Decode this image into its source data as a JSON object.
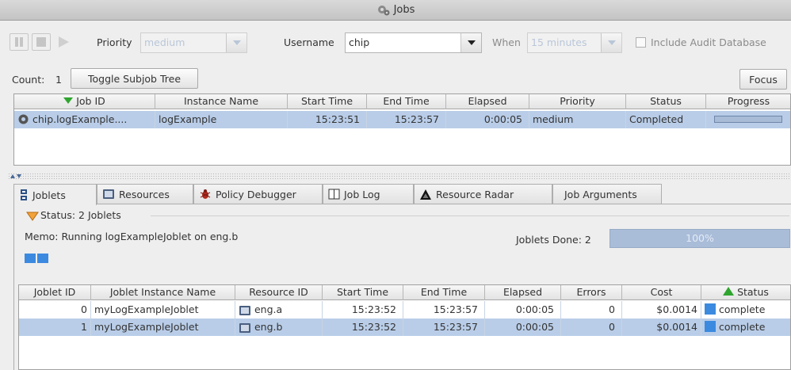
{
  "window": {
    "title": "Jobs",
    "icon": "jobs-gear-icon"
  },
  "toolbar": {
    "priority_label": "Priority",
    "priority_value": "medium",
    "username_label": "Username",
    "username_value": "chip",
    "when_label": "When",
    "when_value": "15 minutes",
    "include_audit_label": "Include Audit Database"
  },
  "count": {
    "label": "Count:",
    "value": "1",
    "toggle_button": "Toggle Subjob Tree",
    "focus_button": "Focus"
  },
  "jobs_table": {
    "columns": [
      "Job ID",
      "Instance Name",
      "Start Time",
      "End Time",
      "Elapsed",
      "Priority",
      "Status",
      "Progress"
    ],
    "rows": [
      {
        "job_id": "chip.logExample....",
        "instance_name": "logExample",
        "start_time": "15:23:51",
        "end_time": "15:23:57",
        "elapsed": "0:00:05",
        "priority": "medium",
        "status": "Completed",
        "progress": 1.0
      }
    ]
  },
  "tabs": [
    {
      "label": "Joblets",
      "icon": "joblets-icon"
    },
    {
      "label": "Resources",
      "icon": "resources-icon"
    },
    {
      "label": "Policy Debugger",
      "icon": "bug-icon"
    },
    {
      "label": "Job Log",
      "icon": "log-icon"
    },
    {
      "label": "Resource Radar",
      "icon": "radar-icon"
    },
    {
      "label": "Job Arguments",
      "icon": ""
    }
  ],
  "joblets": {
    "status_label": "Status: 2 Joblets",
    "memo": "Memo:  Running logExampleJoblet on eng.b",
    "done_label": "Joblets Done: 2",
    "done_percent": "100%",
    "done_fraction": 1.0
  },
  "joblets_table": {
    "columns": [
      "Joblet ID",
      "Joblet Instance Name",
      "Resource ID",
      "Start Time",
      "End Time",
      "Elapsed",
      "Errors",
      "Cost",
      "Status"
    ],
    "rows": [
      {
        "id": "0",
        "name": "myLogExampleJoblet",
        "resource": "eng.a",
        "start": "15:23:52",
        "end": "15:23:57",
        "elapsed": "0:00:05",
        "errors": "0",
        "cost": "$0.0014",
        "status": "complete"
      },
      {
        "id": "1",
        "name": "myLogExampleJoblet",
        "resource": "eng.b",
        "start": "15:23:52",
        "end": "15:23:57",
        "elapsed": "0:00:05",
        "errors": "0",
        "cost": "$0.0014",
        "status": "complete"
      }
    ]
  },
  "colors": {
    "selection": "#b9cde8",
    "status_blue": "#3b8ae0",
    "progress": "#a9bcd8"
  }
}
